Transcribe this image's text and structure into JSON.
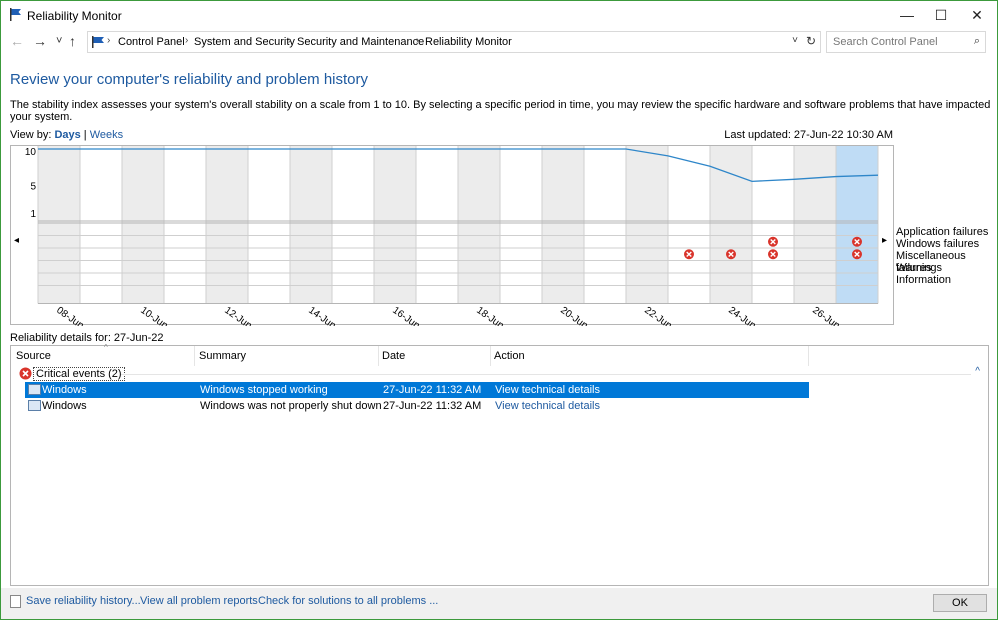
{
  "window": {
    "title": "Reliability Monitor"
  },
  "titlebar": {
    "minimize": "—",
    "maximize": "☐",
    "close": "✕"
  },
  "address": {
    "back": "←",
    "forward": "→",
    "recent": "˅",
    "up": "↑",
    "crumbs": [
      "Control Panel",
      "System and Security",
      "Security and Maintenance",
      "Reliability Monitor"
    ],
    "separator": "›",
    "dropdown": "˅",
    "refresh": "↻"
  },
  "search": {
    "placeholder": "Search Control Panel",
    "icon": "⌕"
  },
  "page": {
    "heading": "Review your computer's reliability and problem history",
    "description": "The stability index assesses your system's overall stability on a scale from 1 to 10. By selecting a specific period in time, you may review the specific hardware and software problems that have impacted your system.",
    "view_by_label": "View by: ",
    "view_days": "Days",
    "view_sep": " | ",
    "view_weeks": "Weeks",
    "last_updated": "Last updated: 27-Jun-22 10:30 AM",
    "details_for": "Reliability details for: 27-Jun-22"
  },
  "chart_data": {
    "type": "line",
    "y_ticks": [
      "10",
      "5",
      "1"
    ],
    "ylim": [
      1,
      10
    ],
    "columns": 20,
    "selected_column": 19,
    "x_labels": [
      "08-Jun-22",
      "10-Jun-22",
      "12-Jun-22",
      "14-Jun-22",
      "16-Jun-22",
      "18-Jun-22",
      "20-Jun-22",
      "22-Jun-22",
      "24-Jun-22",
      "26-Jun-22"
    ],
    "stability_index": [
      10,
      10,
      10,
      10,
      10,
      10,
      10,
      10,
      10,
      10,
      10,
      10,
      10,
      10,
      10,
      9.0,
      7.5,
      5.3,
      5.6,
      6.0,
      6.2
    ],
    "legend": [
      "Application failures",
      "Windows failures",
      "Miscellaneous failures",
      "Warnings",
      "Information"
    ],
    "events": [
      {
        "column": 15,
        "row": 2
      },
      {
        "column": 16,
        "row": 2
      },
      {
        "column": 17,
        "row": 1
      },
      {
        "column": 17,
        "row": 2
      },
      {
        "column": 19,
        "row": 1
      },
      {
        "column": 19,
        "row": 2
      }
    ],
    "nav_left": "◂",
    "nav_right": "▸"
  },
  "table": {
    "columns": [
      "Source",
      "Summary",
      "Date",
      "Action"
    ],
    "sort_indicator": "^",
    "group_label": "Critical events (2)",
    "group_collapse": "^",
    "rows": [
      {
        "source": "Windows",
        "summary": "Windows stopped working",
        "date": "27-Jun-22 11:32 AM",
        "action": "View  technical details",
        "selected": true
      },
      {
        "source": "Windows",
        "summary": "Windows was not properly shut down",
        "date": "27-Jun-22 11:32 AM",
        "action": "View  technical details",
        "selected": false
      }
    ]
  },
  "footer": {
    "save": "Save reliability history...",
    "view_all": "View all problem reports",
    "check": "Check for solutions to all problems ...",
    "ok": "OK"
  },
  "colors": {
    "accent": "#1e5aa0",
    "selection": "#0078d7",
    "error": "#d9342b",
    "line": "#2e86c9",
    "column_shade": "#ececec",
    "selected_column": "#bfdcf5"
  }
}
